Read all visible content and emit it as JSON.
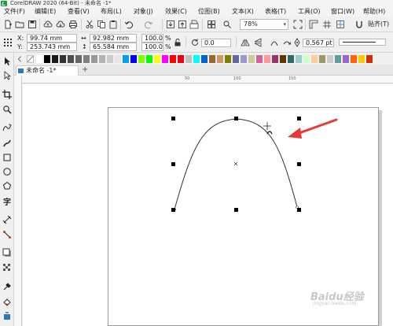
{
  "window": {
    "title": "CorelDRAW 2020 (64-Bit) - 未命名 -1*"
  },
  "menu": [
    {
      "label": "文件(F)"
    },
    {
      "label": "编辑(E)"
    },
    {
      "label": "查看(V)"
    },
    {
      "label": "布局(L)"
    },
    {
      "label": "对象(J)"
    },
    {
      "label": "效果(C)"
    },
    {
      "label": "位图(B)"
    },
    {
      "label": "文本(X)"
    },
    {
      "label": "表格(T)"
    },
    {
      "label": "工具(O)"
    },
    {
      "label": "窗口(W)"
    },
    {
      "label": "帮助(H)"
    }
  ],
  "toolbar": {
    "zoom": "78%",
    "snap_label": "贴齐(T)",
    "icons": [
      "new-icon",
      "open-icon",
      "save-icon",
      "cloud-upload-icon",
      "cloud-download-icon",
      "print-icon",
      "copy-icon",
      "paste-icon",
      "cut-icon",
      "undo-icon",
      "redo-icon",
      "import-icon",
      "export-icon",
      "publish-pdf-icon",
      "fullscreen-icon",
      "rulers-icon",
      "grid-icon",
      "snap-icon"
    ]
  },
  "properties": {
    "x_label": "X:",
    "x_value": "99.74 mm",
    "y_label": "Y:",
    "y_value": "253.743 mm",
    "width_value": "92.982 mm",
    "height_value": "65.584 mm",
    "scale_w": "100.0",
    "scale_h": "100.0",
    "percent_symbol": "%",
    "rotation": "0.0",
    "outline_width": "0.567 pt"
  },
  "palette": {
    "colors": [
      "#ffffff",
      "#000000",
      "#1a1a1a",
      "#333333",
      "#4d4d4d",
      "#666666",
      "#808080",
      "#999999",
      "#b3b3b3",
      "#cccccc",
      "#e6e6e6",
      "#00a0e9",
      "#0000ff",
      "#7fff00",
      "#00ff00",
      "#ffff00",
      "#ff00ff",
      "#ff0000",
      "#e60012",
      "#c0c0c0",
      "#00ffff",
      "#0066cc",
      "#996633",
      "#cc9966",
      "#808000",
      "#666699",
      "#9999cc",
      "#cccc99",
      "#cc6699",
      "#ff9999",
      "#993366",
      "#663300",
      "#336666",
      "#99cccc",
      "#ccffcc",
      "#ffcc99",
      "#999966",
      "#cccccc",
      "#669999",
      "#9966cc",
      "#ff6600",
      "#ffcc00",
      "#cc3300"
    ]
  },
  "document": {
    "tab_label": "未命名 -1*"
  },
  "ruler": {
    "h_ticks": [
      "50",
      "100",
      "150"
    ]
  },
  "tools": [
    "pick-tool-icon",
    "shape-tool-icon",
    "crop-tool-icon",
    "zoom-tool-icon",
    "freehand-tool-icon",
    "artistic-media-icon",
    "rectangle-tool-icon",
    "ellipse-tool-icon",
    "polygon-tool-icon",
    "text-tool-icon",
    "parallel-dimension-icon",
    "connector-tool-icon",
    "drop-shadow-icon",
    "transparency-icon",
    "eyedropper-icon",
    "interactive-fill-icon",
    "smart-fill-icon"
  ],
  "watermark": {
    "main": "Baidu经验",
    "sub": "jingyan.baidu.com"
  },
  "colors": {
    "arrow": "#e53935",
    "handle": "#000000",
    "curve": "#333333",
    "page_border": "#9a9a9a",
    "accent": "#2b78c2"
  }
}
